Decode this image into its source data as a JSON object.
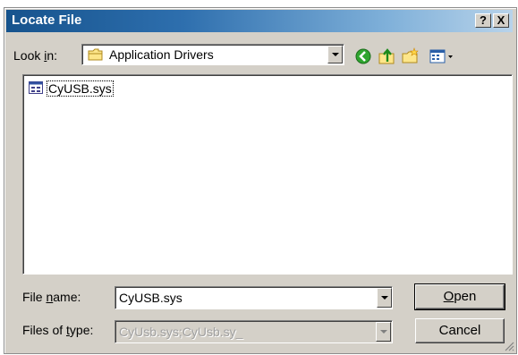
{
  "window": {
    "title": "Locate File"
  },
  "title_buttons": {
    "help": "?",
    "close": "X"
  },
  "look_in": {
    "label_prefix": "Look ",
    "label_underlined": "i",
    "label_suffix": "n:",
    "value": "Application Drivers",
    "folder_icon": "folder-icon"
  },
  "toolbar_icons": [
    "back-icon",
    "up-folder-icon",
    "new-folder-icon",
    "view-menu-icon"
  ],
  "files": [
    {
      "name": "CyUSB.sys",
      "icon": "system-file-icon"
    }
  ],
  "file_name": {
    "label_prefix": "File ",
    "label_underlined": "n",
    "label_suffix": "ame:",
    "value": "CyUSB.sys"
  },
  "file_type": {
    "label_prefix": "Files of ",
    "label_underlined": "t",
    "label_suffix": "ype:",
    "value": "CyUsb.sys;CyUsb.sy_"
  },
  "buttons": {
    "open_underlined": "O",
    "open_rest": "pen",
    "cancel": "Cancel"
  },
  "colors": {
    "title_start": "#16538d",
    "title_end": "#b8d3ea",
    "face": "#d4d0c8"
  }
}
